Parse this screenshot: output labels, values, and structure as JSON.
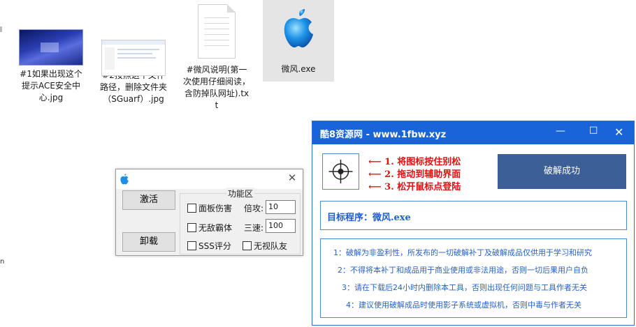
{
  "desktop": {
    "files": [
      {
        "name": "#1如果出现这个提示ACE安全中心.jpg",
        "icon": "ace-screenshot-thumbnail"
      },
      {
        "name": "#2按照这个文件路径，删除文件夹（SGuarf）.jpg",
        "icon": "folder-screenshot-thumbnail"
      },
      {
        "name": "#微风说明(第一次使用仔细阅读，含防掉队网址).txt",
        "icon": "text-document-icon"
      },
      {
        "name": "微风.exe",
        "icon": "apple-logo-icon"
      }
    ]
  },
  "dialog": {
    "activate_label": "激活",
    "uninstall_label": "卸载",
    "group_title": "功能区",
    "options": {
      "panel_damage": "面板伤害",
      "invincible": "无敌霸体",
      "sss_rating": "SSS评分",
      "ignore_team": "无视队友"
    },
    "multiplier_label": "倍攻:",
    "multiplier_value": "10",
    "speed_label": "三速:",
    "speed_value": "100"
  },
  "crack_window": {
    "title": "酷8资源网 - www.1fbw.xyz",
    "steps": [
      "1. 将图标按住别松",
      "2. 拖动到辅助界面",
      "3. 松开鼠标点登陆"
    ],
    "crack_button": "破解成功",
    "target_label": "目标程序：微风.exe",
    "notices": [
      "1：破解为非盈利性，所发布的一切破解补丁及破解成品仅供用于学习和研究",
      "2：不得将本补丁和成品用于商业使用或非法用途，否则一切后果用户自负",
      "3：请在下载后24小时内删除本工具，否则出现任何问题与工具作者无关",
      "4：建议使用破解成品时使用影子系统或虚拟机，否则中毒与作者无关"
    ],
    "colors": {
      "titlebar": "#1a64d9",
      "button": "#3d5f98",
      "steps": "#e01010",
      "text": "#2a62c6"
    }
  },
  "edge_text": "n"
}
